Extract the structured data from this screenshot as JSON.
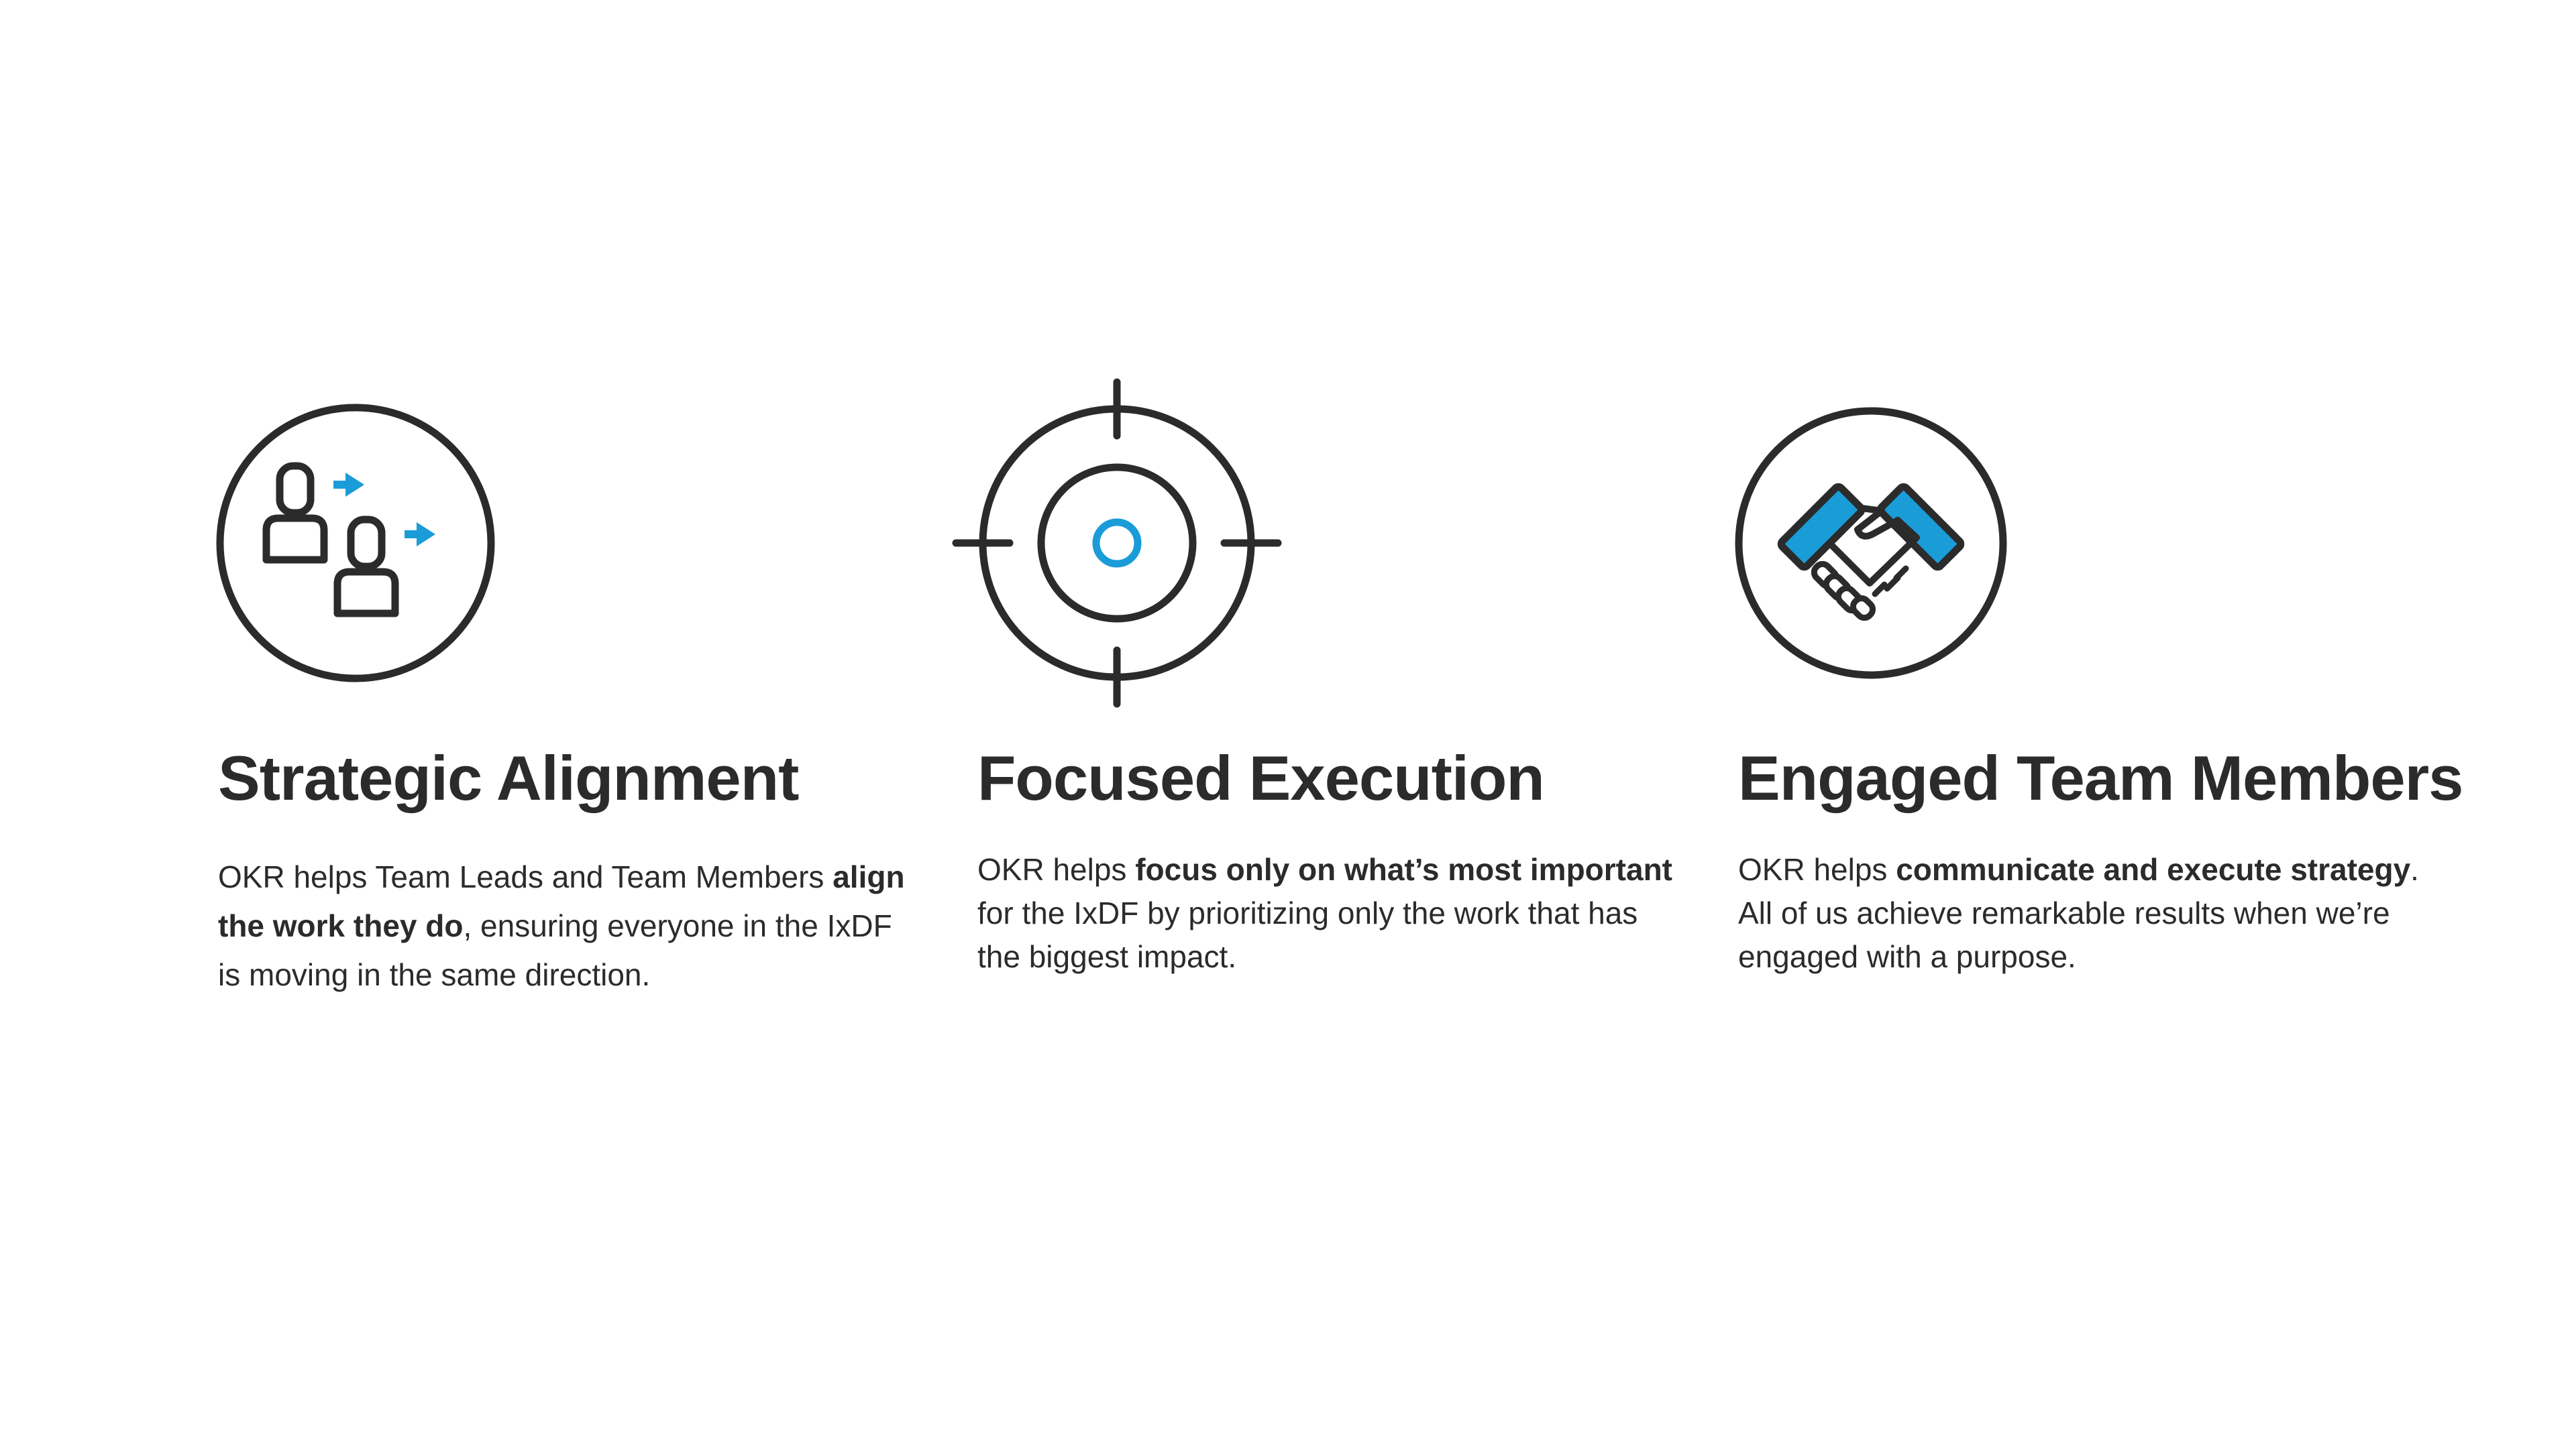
{
  "accent_color": "#1A9CD8",
  "ink_color": "#2B2B2B",
  "features": [
    {
      "icon": "people-alignment-icon",
      "title": "Strategic Alignment",
      "desc_pre": "OKR helps Team Leads and Team Members ",
      "desc_bold": "align the work they do",
      "desc_post": ", ensuring everyone in the IxDF is moving in the same direction."
    },
    {
      "icon": "target-crosshair-icon",
      "title": "Focused Execution",
      "desc_pre": "OKR helps ",
      "desc_bold": "focus only on what’s most important",
      "desc_post": " for the IxDF by prioritizing only the work that has the biggest impact."
    },
    {
      "icon": "handshake-icon",
      "title": "Engaged Team Members",
      "desc_pre": "OKR helps ",
      "desc_bold": "communicate and execute strategy",
      "desc_post": ". All of us achieve remarkable results when we’re engaged with a purpose."
    }
  ]
}
